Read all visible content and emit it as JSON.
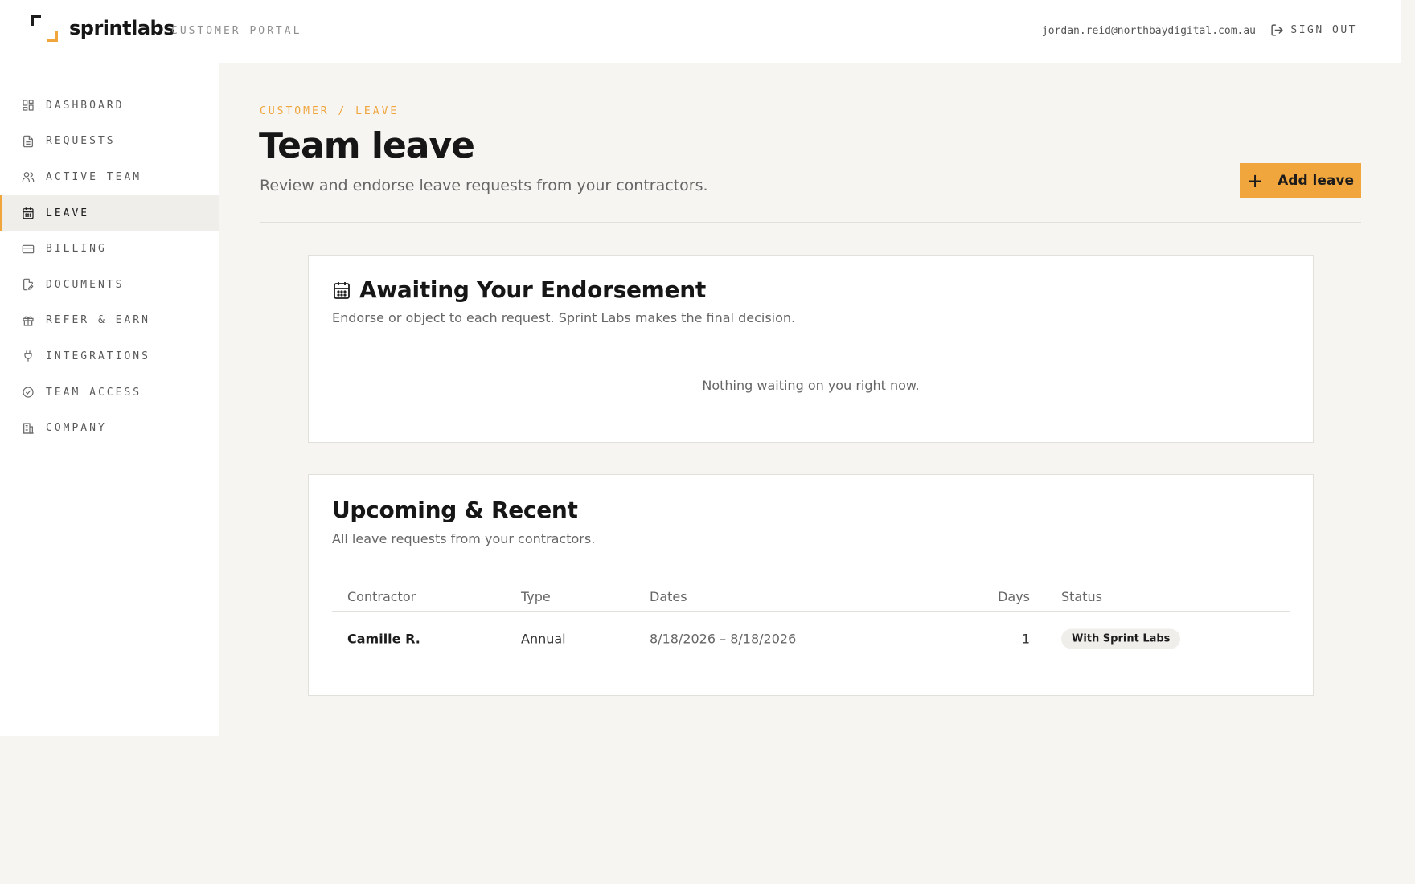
{
  "header": {
    "brand": "sprintlabs",
    "portal_label": "CUSTOMER PORTAL",
    "user_email": "jordan.reid@northbaydigital.com.au",
    "signout_label": "SIGN OUT"
  },
  "sidebar": {
    "items": [
      {
        "label": "DASHBOARD",
        "icon": "dashboard-icon",
        "active": false
      },
      {
        "label": "REQUESTS",
        "icon": "document-icon",
        "active": false
      },
      {
        "label": "ACTIVE TEAM",
        "icon": "users-icon",
        "active": false
      },
      {
        "label": "LEAVE",
        "icon": "calendar-icon",
        "active": true
      },
      {
        "label": "BILLING",
        "icon": "credit-card-icon",
        "active": false
      },
      {
        "label": "DOCUMENTS",
        "icon": "document-edit-icon",
        "active": false
      },
      {
        "label": "REFER & EARN",
        "icon": "gift-icon",
        "active": false
      },
      {
        "label": "INTEGRATIONS",
        "icon": "plug-icon",
        "active": false
      },
      {
        "label": "TEAM ACCESS",
        "icon": "check-circle-icon",
        "active": false
      },
      {
        "label": "COMPANY",
        "icon": "building-icon",
        "active": false
      }
    ]
  },
  "page": {
    "breadcrumb": "CUSTOMER / LEAVE",
    "title": "Team leave",
    "subtitle": "Review and endorse leave requests from your contractors.",
    "add_button_label": "Add leave"
  },
  "awaiting": {
    "title": "Awaiting Your Endorsement",
    "description": "Endorse or object to each request. Sprint Labs makes the final decision.",
    "empty_message": "Nothing waiting on you right now."
  },
  "upcoming": {
    "title": "Upcoming & Recent",
    "description": "All leave requests from your contractors.",
    "columns": [
      "Contractor",
      "Type",
      "Dates",
      "Days",
      "Status"
    ],
    "rows": [
      {
        "contractor": "Camille R.",
        "type": "Annual",
        "dates": "8/18/2026 – 8/18/2026",
        "days": "1",
        "status": "With Sprint Labs"
      }
    ]
  },
  "colors": {
    "accent": "#f0a63d",
    "background": "#f6f5f2",
    "text": "#1c1c1c"
  }
}
